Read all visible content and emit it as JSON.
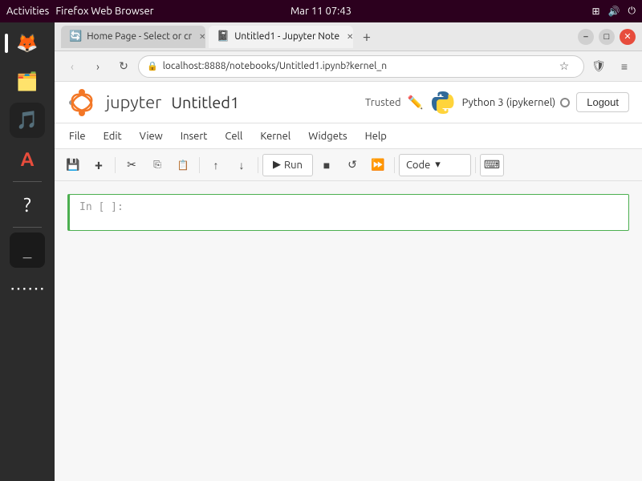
{
  "desktop": {
    "topbar": {
      "activities": "Activities",
      "browser_title": "Firefox Web Browser",
      "datetime": "Mar 11  07:43"
    }
  },
  "sidebar": {
    "icons": [
      {
        "id": "firefox",
        "symbol": "🦊",
        "active": true
      },
      {
        "id": "files",
        "symbol": "🗂️",
        "active": false
      },
      {
        "id": "music",
        "symbol": "🎵",
        "active": false
      },
      {
        "id": "appstore",
        "symbol": "🅐",
        "active": false
      },
      {
        "id": "help",
        "symbol": "❓",
        "active": false
      },
      {
        "id": "terminal",
        "symbol": "⬛",
        "active": false
      },
      {
        "id": "apps",
        "symbol": "⋯",
        "active": false
      }
    ]
  },
  "browser": {
    "tabs": [
      {
        "id": "home",
        "label": "Home Page - Select or cr",
        "active": false,
        "favicon": "🔄"
      },
      {
        "id": "notebook",
        "label": "Untitled1 - Jupyter Note",
        "active": true,
        "favicon": "📓"
      }
    ],
    "new_tab_label": "+",
    "window_controls": {
      "minimize": "–",
      "maximize": "□",
      "close": "✕"
    },
    "nav": {
      "back": "‹",
      "forward": "›",
      "refresh": "↻",
      "address": "localhost:8888/notebooks/Untitled1.ipynb?kernel_n",
      "star": "☆",
      "shield": "🛡",
      "menu": "≡"
    },
    "jupyter": {
      "logo_text": "jupyter",
      "notebook_name": "Untitled1",
      "trusted_label": "Trusted",
      "kernel_label": "Python 3 (ipykernel)",
      "logout_label": "Logout",
      "menu_items": [
        "File",
        "Edit",
        "View",
        "Insert",
        "Cell",
        "Kernel",
        "Widgets",
        "Help"
      ],
      "toolbar": {
        "run_label": "Run",
        "cell_type": "Code"
      },
      "cell": {
        "prompt": "In [ ]:",
        "content": ""
      }
    }
  }
}
